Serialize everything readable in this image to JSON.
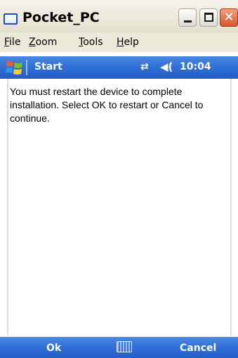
{
  "window": {
    "title": "Pocket_PC",
    "close_glyph": "✕"
  },
  "menu": {
    "items": [
      {
        "underline": "F",
        "rest": "ile"
      },
      {
        "underline": "Z",
        "rest": "oom"
      },
      {
        "underline": "T",
        "rest": "ools"
      },
      {
        "underline": "H",
        "rest": "elp"
      }
    ]
  },
  "startbar": {
    "start_label": "Start",
    "connectivity_glyph": "⇄",
    "volume_glyph": "◀(",
    "time": "10:04"
  },
  "message": "You must restart the device to complete installation. Select OK to restart or Cancel to continue.",
  "softkeys": {
    "left": "Ok",
    "right": "Cancel"
  },
  "colors": {
    "taskbar_blue": "#2f6fd6",
    "xp_face": "#ece9d8"
  }
}
